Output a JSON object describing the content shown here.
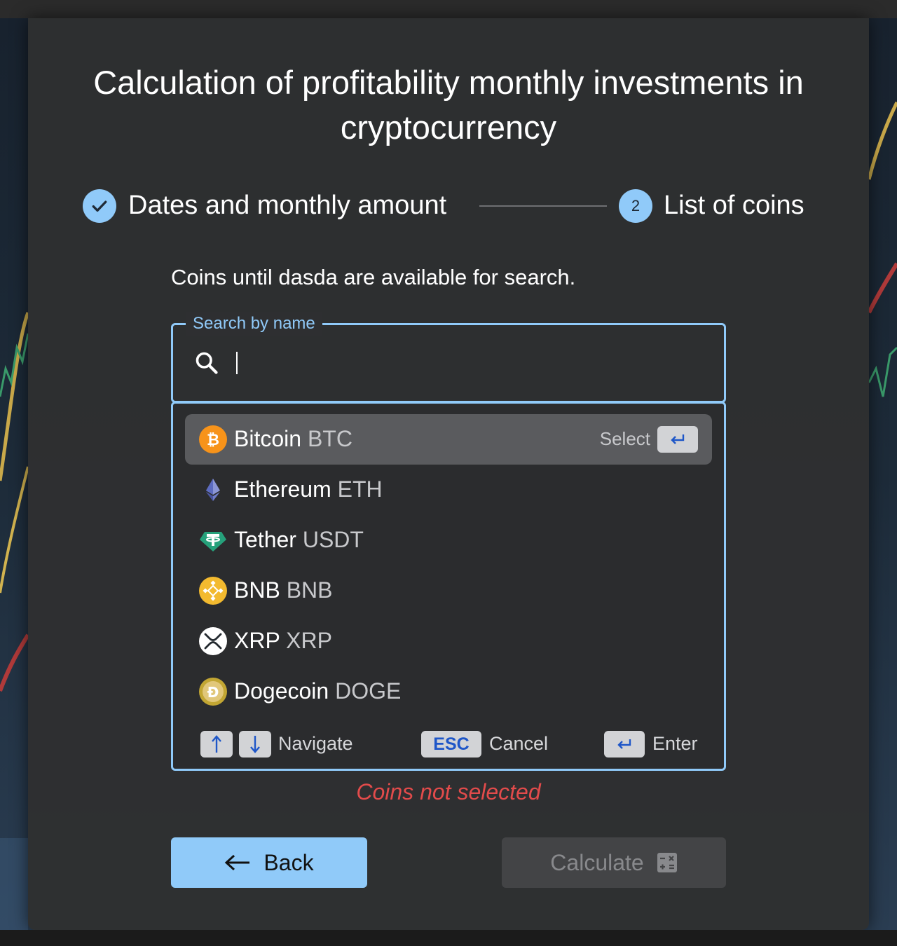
{
  "page": {
    "title": "Calculation of profitability monthly investments in cryptocurrency"
  },
  "stepper": {
    "steps": [
      {
        "label": "Dates and monthly amount",
        "status": "completed",
        "icon": "check-icon"
      },
      {
        "label": "List of coins",
        "number": "2",
        "status": "active"
      }
    ]
  },
  "hint": "Coins until dasda are available for search.",
  "search": {
    "label": "Search by name",
    "value": "",
    "icon": "search-icon"
  },
  "coins": [
    {
      "name": "Bitcoin",
      "symbol": "BTC",
      "icon": "bitcoin-icon",
      "color": "#f7931a",
      "active": true
    },
    {
      "name": "Ethereum",
      "symbol": "ETH",
      "icon": "ethereum-icon",
      "color": "#627eea"
    },
    {
      "name": "Tether",
      "symbol": "USDT",
      "icon": "tether-icon",
      "color": "#26a17b"
    },
    {
      "name": "BNB",
      "symbol": "BNB",
      "icon": "bnb-icon",
      "color": "#f3ba2f"
    },
    {
      "name": "XRP",
      "symbol": "XRP",
      "icon": "xrp-icon",
      "color": "#ffffff"
    },
    {
      "name": "Dogecoin",
      "symbol": "DOGE",
      "icon": "dogecoin-icon",
      "color": "#c2a633"
    }
  ],
  "select_hint": "Select",
  "keyboard_hints": {
    "navigate": "Navigate",
    "esc_key": "ESC",
    "cancel": "Cancel",
    "enter": "Enter"
  },
  "error": "Coins not selected",
  "buttons": {
    "back": "Back",
    "calculate": "Calculate"
  },
  "colors": {
    "accent": "#90caf9",
    "error": "#e24b4b",
    "card": "#2e2f31",
    "key_text": "#1e56c8"
  }
}
